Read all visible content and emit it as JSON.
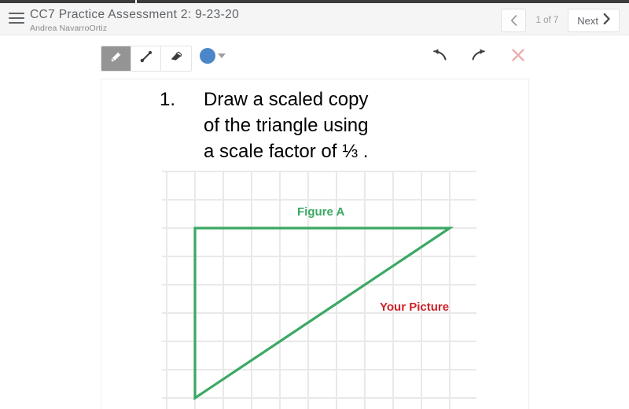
{
  "header": {
    "menu_icon": "hamburger-icon",
    "title": "CC7 Practice Assessment 2: 9-23-20",
    "subtitle": "Andrea NavarroOrtiz",
    "prev_icon": "chevron-left-icon",
    "page_indicator": "1 of 7",
    "next_label": "Next",
    "next_icon": "chevron-right-icon"
  },
  "toolbar": {
    "tools": [
      {
        "name": "pencil-tool",
        "icon": "pencil-icon",
        "active": true
      },
      {
        "name": "line-tool",
        "icon": "line-icon",
        "active": false
      },
      {
        "name": "eraser-tool",
        "icon": "eraser-icon",
        "active": false
      }
    ],
    "color": {
      "name": "color-swatch",
      "value": "#4a86c8",
      "dropdown_icon": "caret-down-icon"
    },
    "actions": [
      {
        "name": "undo-button",
        "icon": "undo-arrow-icon"
      },
      {
        "name": "redo-button",
        "icon": "redo-arrow-icon"
      },
      {
        "name": "clear-button",
        "icon": "close-x-icon"
      }
    ]
  },
  "question": {
    "number": "1.",
    "text": "Draw a scaled copy\nof the triangle using\na scale factor of ⅓ ."
  },
  "figure": {
    "label_a": "Figure A",
    "label_your_picture": "Your Picture",
    "shape_color": "#3aa863",
    "your_picture_color": "#cc2229",
    "grid_color": "#e8e8e8"
  },
  "chart_data": {
    "type": "scatter",
    "title": "Figure A",
    "xlabel": "",
    "ylabel": "",
    "grid": true,
    "cell_size_px": 36,
    "grid_columns": 11,
    "grid_rows": 8,
    "annotations": [
      "Figure A",
      "Your Picture"
    ],
    "series": [
      {
        "name": "Figure A triangle",
        "color": "#3aa863",
        "closed": true,
        "points_grid": [
          [
            1,
            2
          ],
          [
            10,
            2
          ],
          [
            1,
            8
          ]
        ],
        "side_lengths_units": {
          "horizontal": 9,
          "vertical": 6
        }
      }
    ]
  }
}
